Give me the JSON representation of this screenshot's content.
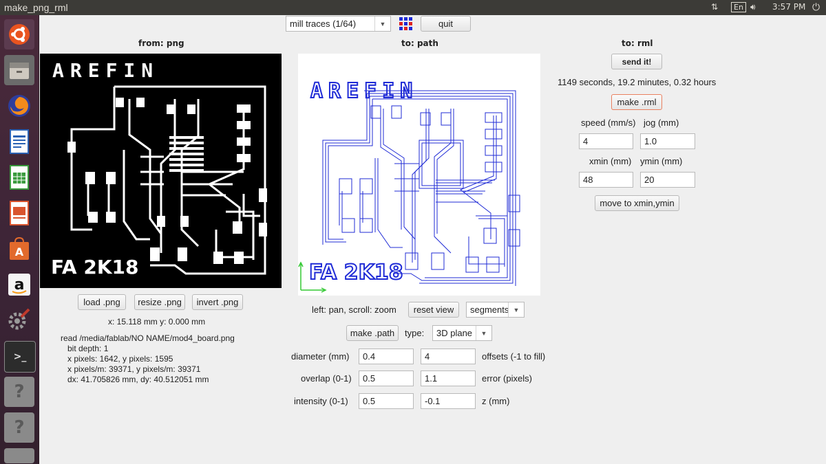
{
  "window": {
    "title": "make_png_rml"
  },
  "indicators": {
    "lang": "En",
    "time": "3:57 PM"
  },
  "launcher": [
    {
      "name": "ubuntu-dash-icon"
    },
    {
      "name": "files-icon"
    },
    {
      "name": "firefox-icon"
    },
    {
      "name": "writer-icon"
    },
    {
      "name": "calc-icon"
    },
    {
      "name": "impress-icon"
    },
    {
      "name": "software-center-icon"
    },
    {
      "name": "amazon-icon"
    },
    {
      "name": "system-settings-icon"
    },
    {
      "name": "terminal-icon"
    },
    {
      "name": "unknown-app-icon"
    },
    {
      "name": "unknown-app-icon"
    }
  ],
  "toolbar": {
    "mode_select": "mill traces (1/64)",
    "quit_label": "quit"
  },
  "headers": {
    "from": "from: png",
    "to_path": "to: path",
    "to_rml": "to: rml"
  },
  "png": {
    "load_label": "load .png",
    "resize_label": "resize .png",
    "invert_label": "invert .png",
    "coords": "x: 15.118 mm  y: 0.000 mm",
    "info": [
      "read /media/fablab/NO NAME/mod4_board.png",
      "   bit depth: 1",
      "   x pixels: 1642, y pixels: 1595",
      "   x pixels/m: 39371, y pixels/m: 39371",
      "   dx: 41.705826 mm, dy: 40.512051 mm"
    ],
    "board_text_top": "AREFIN",
    "board_text_bottom": "FA 2K18"
  },
  "path": {
    "nav_hint": "left: pan, scroll: zoom",
    "reset_label": "reset view",
    "view_select": "segments",
    "make_label": "make .path",
    "type_label": "type:",
    "type_select": "3D plane",
    "diameter_label": "diameter (mm)",
    "diameter": "0.4",
    "offsets": "4",
    "offsets_label": "offsets (-1 to fill)",
    "overlap_label": "overlap (0-1)",
    "overlap": "0.5",
    "error": "1.1",
    "error_label": "error (pixels)",
    "intensity_label": "intensity (0-1)",
    "intensity": "0.5",
    "z": "-0.1",
    "z_label": "z (mm)"
  },
  "rml": {
    "send_label": "send it!",
    "time_estimate": "1149 seconds, 19.2 minutes, 0.32 hours",
    "make_label": "make .rml",
    "speed_label": "speed (mm/s)",
    "jog_label": "jog (mm)",
    "speed": "4",
    "jog": "1.0",
    "xmin_label": "xmin (mm)",
    "ymin_label": "ymin (mm)",
    "xmin": "48",
    "ymin": "20",
    "move_label": "move to xmin,ymin"
  },
  "colors": {
    "toolpath": "#1f2bd6",
    "axis": "#32c832",
    "launcher_bg": "#3b2436"
  }
}
